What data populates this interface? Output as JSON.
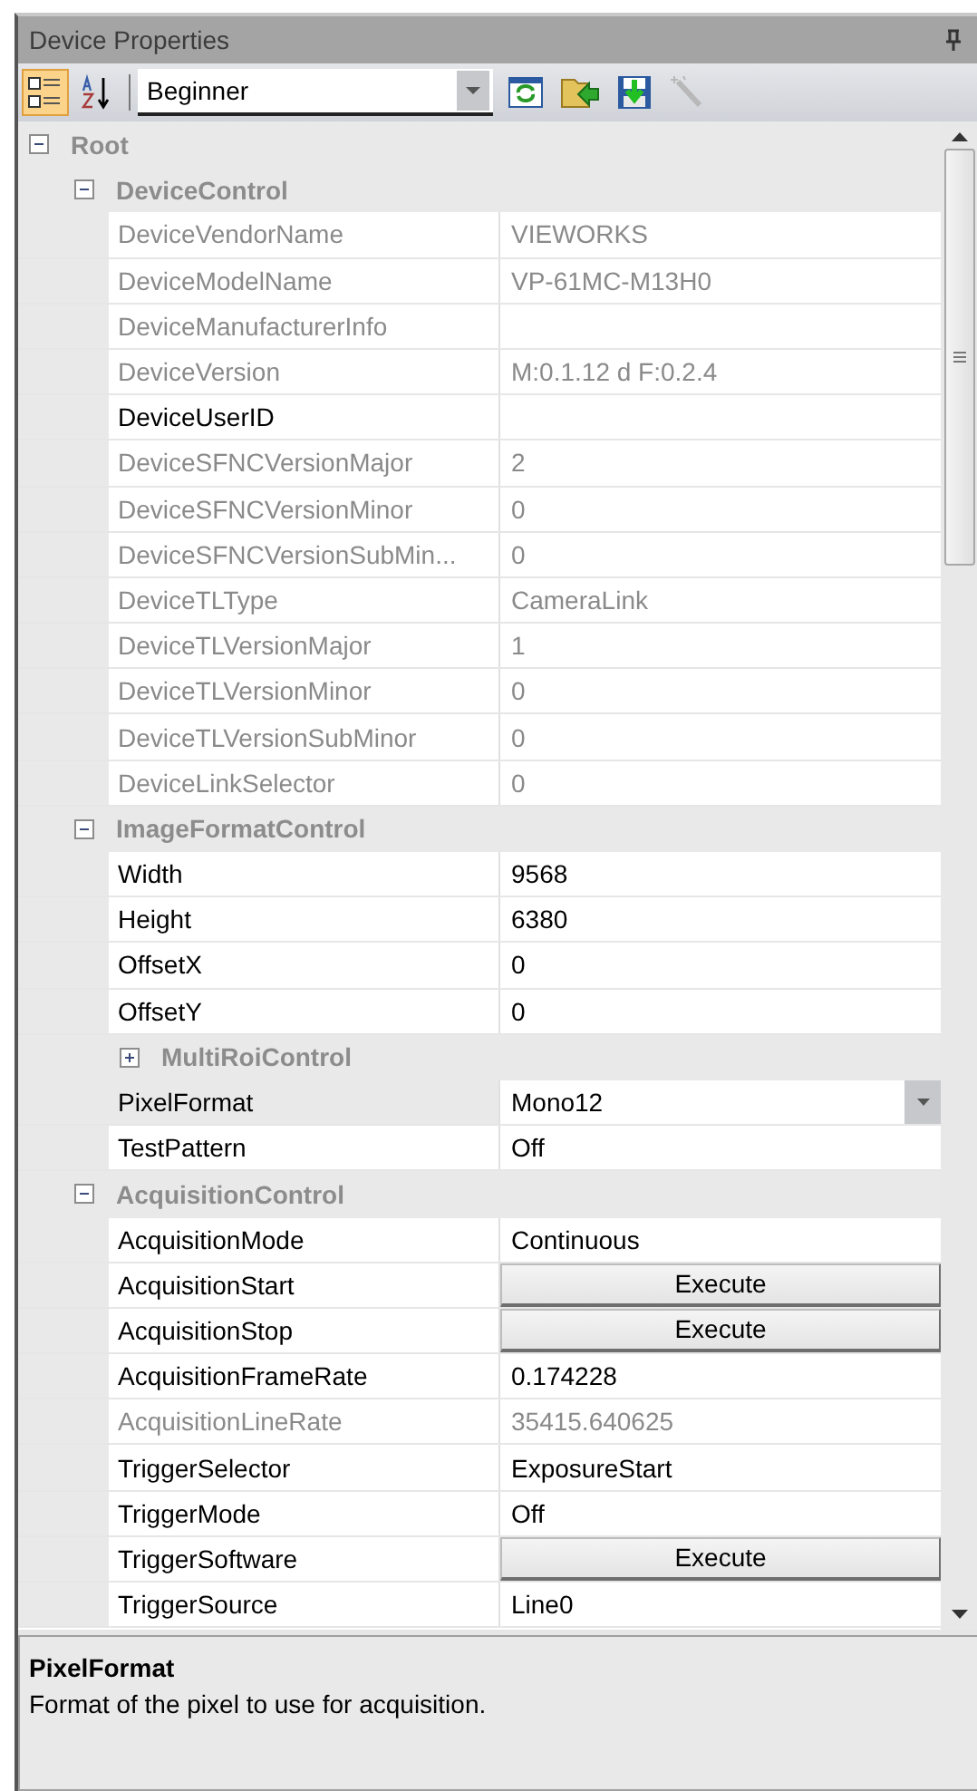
{
  "panel": {
    "title": "Device Properties"
  },
  "toolbar": {
    "categorized": {
      "selected": true
    },
    "alphabetical": {
      "selected": false
    },
    "visibility": {
      "value": "Beginner"
    },
    "wizard": {
      "disabled": true
    }
  },
  "tree": [
    {
      "kind": "group",
      "label": "Root",
      "expanded": true,
      "children": [
        {
          "kind": "group",
          "label": "DeviceControl",
          "expanded": true,
          "children": [
            {
              "kind": "text",
              "name": "DeviceVendorName",
              "value": "VIEWORKS",
              "readonly": true,
              "selected": false
            },
            {
              "kind": "text",
              "name": "DeviceModelName",
              "value": "VP-61MC-M13H0",
              "readonly": true,
              "selected": false
            },
            {
              "kind": "text",
              "name": "DeviceManufacturerInfo",
              "readonly": true,
              "selected": false
            },
            {
              "kind": "text",
              "name": "DeviceVersion",
              "value": "M:0.1.12 d F:0.2.4",
              "readonly": true,
              "selected": false
            },
            {
              "kind": "text",
              "name": "DeviceUserID",
              "readonly": false,
              "selected": false
            },
            {
              "kind": "text",
              "name": "DeviceSFNCVersionMajor",
              "value": "2",
              "readonly": true,
              "selected": false
            },
            {
              "kind": "text",
              "name": "DeviceSFNCVersionMinor",
              "value": "0",
              "readonly": true,
              "selected": false
            },
            {
              "kind": "text",
              "name": "DeviceSFNCVersionSubMin...",
              "value": "0",
              "readonly": true,
              "selected": false
            },
            {
              "kind": "text",
              "name": "DeviceTLType",
              "value": "CameraLink",
              "readonly": true,
              "selected": false
            },
            {
              "kind": "text",
              "name": "DeviceTLVersionMajor",
              "value": "1",
              "readonly": true,
              "selected": false
            },
            {
              "kind": "text",
              "name": "DeviceTLVersionMinor",
              "value": "0",
              "readonly": true,
              "selected": false
            },
            {
              "kind": "text",
              "name": "DeviceTLVersionSubMinor",
              "value": "0",
              "readonly": true,
              "selected": false
            },
            {
              "kind": "text",
              "name": "DeviceLinkSelector",
              "value": "0",
              "readonly": true,
              "selected": false
            }
          ]
        },
        {
          "kind": "group",
          "label": "ImageFormatControl",
          "expanded": true,
          "children": [
            {
              "kind": "text",
              "name": "Width",
              "value": "9568",
              "readonly": false,
              "selected": false
            },
            {
              "kind": "text",
              "name": "Height",
              "value": "6380",
              "readonly": false,
              "selected": false
            },
            {
              "kind": "text",
              "name": "OffsetX",
              "value": "0",
              "readonly": false,
              "selected": false
            },
            {
              "kind": "text",
              "name": "OffsetY",
              "value": "0",
              "readonly": false,
              "selected": false
            },
            {
              "kind": "group",
              "label": "MultiRoiControl",
              "expanded": false
            },
            {
              "kind": "dropdown",
              "name": "PixelFormat",
              "value": "Mono12",
              "readonly": false,
              "selected": true
            },
            {
              "kind": "text",
              "name": "TestPattern",
              "value": "Off",
              "readonly": false,
              "selected": false
            }
          ]
        },
        {
          "kind": "group",
          "label": "AcquisitionControl",
          "expanded": true,
          "children": [
            {
              "kind": "text",
              "name": "AcquisitionMode",
              "value": "Continuous",
              "readonly": false,
              "selected": false
            },
            {
              "kind": "button",
              "name": "AcquisitionStart",
              "value": "Execute",
              "readonly": false,
              "selected": false
            },
            {
              "kind": "button",
              "name": "AcquisitionStop",
              "value": "Execute",
              "readonly": false,
              "selected": false
            },
            {
              "kind": "text",
              "name": "AcquisitionFrameRate",
              "value": "0.174228",
              "readonly": false,
              "selected": false
            },
            {
              "kind": "text",
              "name": "AcquisitionLineRate",
              "value": "35415.640625",
              "readonly": true,
              "selected": false
            },
            {
              "kind": "text",
              "name": "TriggerSelector",
              "value": "ExposureStart",
              "readonly": false,
              "selected": false
            },
            {
              "kind": "text",
              "name": "TriggerMode",
              "value": "Off",
              "readonly": false,
              "selected": false
            },
            {
              "kind": "button",
              "name": "TriggerSoftware",
              "value": "Execute",
              "readonly": false,
              "selected": false
            },
            {
              "kind": "text",
              "name": "TriggerSource",
              "value": "Line0",
              "readonly": false,
              "selected": false
            }
          ]
        }
      ]
    }
  ],
  "description": {
    "title": "PixelFormat",
    "text": "Format of the pixel to use for acquisition."
  }
}
